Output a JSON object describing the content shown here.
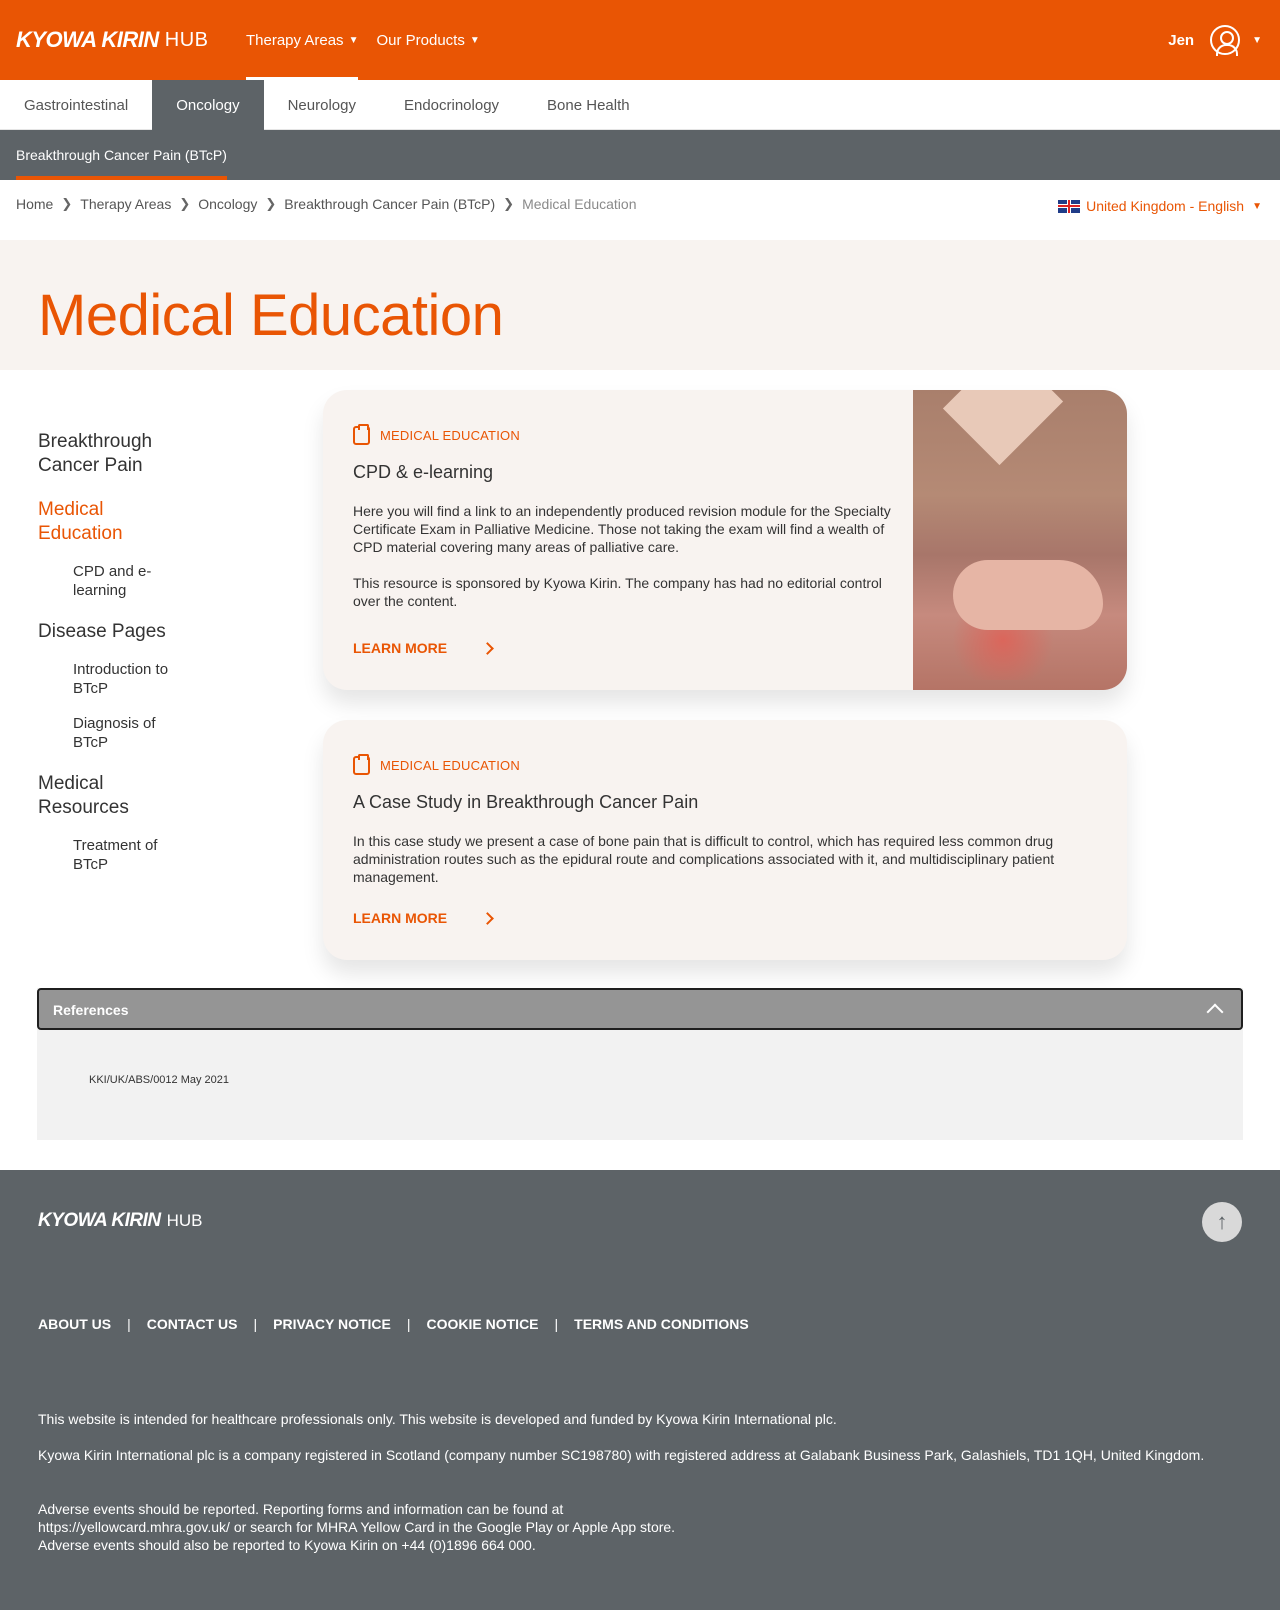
{
  "header": {
    "brand": "KYOWA KIRIN",
    "hub": "HUB",
    "nav": [
      {
        "label": "Therapy Areas"
      },
      {
        "label": "Our Products"
      }
    ],
    "user_name": "Jen"
  },
  "tabs": [
    "Gastrointestinal",
    "Oncology",
    "Neurology",
    "Endocrinology",
    "Bone Health"
  ],
  "active_tab": "Oncology",
  "subnav": {
    "label": "Breakthrough Cancer Pain (BTcP)"
  },
  "breadcrumb": [
    "Home",
    "Therapy Areas",
    "Oncology",
    "Breakthrough Cancer Pain (BTcP)",
    "Medical Education"
  ],
  "locale": {
    "label": "United Kingdom - English"
  },
  "page_title": "Medical Education",
  "sidenav": [
    {
      "label": "Breakthrough Cancer Pain",
      "level": 1
    },
    {
      "label": "Medical Education",
      "level": 1,
      "active": true
    },
    {
      "label": "CPD and e-learning",
      "level": 2
    },
    {
      "label": "Disease Pages",
      "level": 1
    },
    {
      "label": "Introduction to BTcP",
      "level": 2
    },
    {
      "label": "Diagnosis of BTcP",
      "level": 2
    },
    {
      "label": "Medical Resources",
      "level": 1
    },
    {
      "label": "Treatment of BTcP",
      "level": 2
    }
  ],
  "cards": [
    {
      "kicker": "MEDICAL EDUCATION",
      "title": "CPD & e-learning",
      "paragraphs": [
        "Here you will find a link to an independently produced revision module for the Specialty Certificate Exam in Palliative Medicine. Those not taking the exam will find a wealth of CPD material covering many areas of palliative care.",
        "This resource is sponsored by Kyowa Kirin. The company has had no editorial control over the content."
      ],
      "cta": "LEARN MORE"
    },
    {
      "kicker": "MEDICAL EDUCATION",
      "title": "A Case Study in Breakthrough Cancer Pain",
      "paragraphs": [
        "In this case study we present a case of bone pain that is difficult to control, which has required less common drug administration routes such as the epidural route and complications associated with it, and multidisciplinary patient management."
      ],
      "cta": "LEARN MORE"
    }
  ],
  "references": {
    "title": "References",
    "code": "KKI/UK/ABS/0012  May 2021"
  },
  "footer": {
    "brand": "KYOWA KIRIN",
    "hub": "HUB",
    "links": [
      "ABOUT US",
      "CONTACT US",
      "PRIVACY NOTICE",
      "COOKIE NOTICE",
      "TERMS AND CONDITIONS"
    ],
    "p1": "This website is intended for healthcare professionals only. This website is developed and funded by Kyowa Kirin International plc.",
    "p2": "Kyowa Kirin International plc is a company registered in Scotland (company number SC198780) with registered address at Galabank Business Park, Galashiels, TD1 1QH, United Kingdom.",
    "p3a": "Adverse events should be reported. Reporting forms and information can be found at",
    "p3b": "https://yellowcard.mhra.gov.uk/ or search for MHRA Yellow Card in the Google Play or Apple App store.",
    "p3c": "Adverse events should also be reported to Kyowa Kirin on +44 (0)1896 664 000."
  },
  "colors": {
    "brand_orange": "#e95504",
    "dark_grey": "#5d6367",
    "cream": "#f8f3f0"
  }
}
